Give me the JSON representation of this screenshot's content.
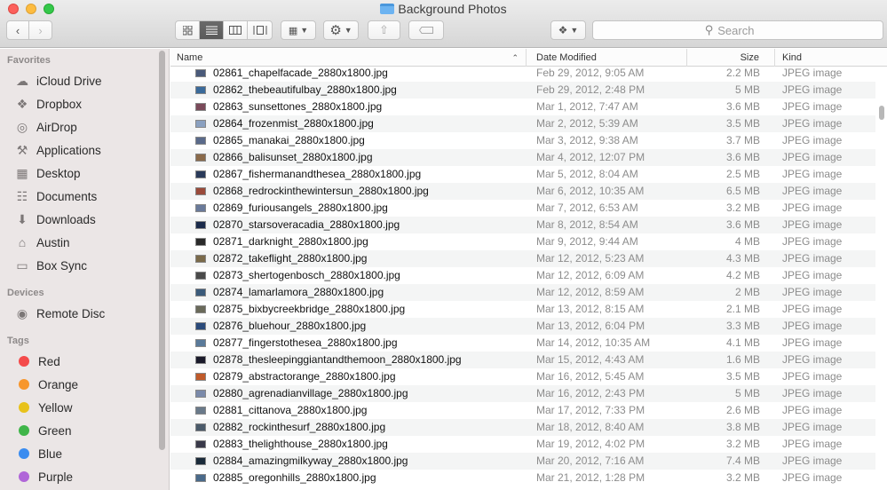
{
  "window": {
    "title": "Background Photos"
  },
  "toolbar": {
    "back_icon": "chevron-left-icon",
    "forward_icon": "chevron-right-icon",
    "view_modes": [
      "icon-view",
      "list-view",
      "column-view",
      "coverflow-view"
    ],
    "active_view": "list-view",
    "search_placeholder": "Search"
  },
  "sidebar": {
    "favorites_heading": "Favorites",
    "favorites": [
      {
        "label": "iCloud Drive",
        "icon": "cloud-icon"
      },
      {
        "label": "Dropbox",
        "icon": "dropbox-icon"
      },
      {
        "label": "AirDrop",
        "icon": "airdrop-icon"
      },
      {
        "label": "Applications",
        "icon": "applications-icon"
      },
      {
        "label": "Desktop",
        "icon": "desktop-icon"
      },
      {
        "label": "Documents",
        "icon": "documents-icon"
      },
      {
        "label": "Downloads",
        "icon": "downloads-icon"
      },
      {
        "label": "Austin",
        "icon": "home-icon"
      },
      {
        "label": "Box Sync",
        "icon": "folder-icon"
      }
    ],
    "devices_heading": "Devices",
    "devices": [
      {
        "label": "Remote Disc",
        "icon": "disc-icon"
      }
    ],
    "tags_heading": "Tags",
    "tags": [
      {
        "label": "Red",
        "color": "#f44a4a"
      },
      {
        "label": "Orange",
        "color": "#f7962c"
      },
      {
        "label": "Yellow",
        "color": "#e8c21b"
      },
      {
        "label": "Green",
        "color": "#3fb549"
      },
      {
        "label": "Blue",
        "color": "#3a8cf0"
      },
      {
        "label": "Purple",
        "color": "#b066d8"
      }
    ]
  },
  "columns": {
    "name": "Name",
    "date": "Date Modified",
    "size": "Size",
    "kind": "Kind"
  },
  "files": [
    {
      "name": "02861_chapelfacade_2880x1800.jpg",
      "date": "Feb 29, 2012, 9:05 AM",
      "size": "2.2 MB",
      "kind": "JPEG image"
    },
    {
      "name": "02862_thebeautifulbay_2880x1800.jpg",
      "date": "Feb 29, 2012, 2:48 PM",
      "size": "5 MB",
      "kind": "JPEG image"
    },
    {
      "name": "02863_sunsettones_2880x1800.jpg",
      "date": "Mar 1, 2012, 7:47 AM",
      "size": "3.6 MB",
      "kind": "JPEG image"
    },
    {
      "name": "02864_frozenmist_2880x1800.jpg",
      "date": "Mar 2, 2012, 5:39 AM",
      "size": "3.5 MB",
      "kind": "JPEG image"
    },
    {
      "name": "02865_manakai_2880x1800.jpg",
      "date": "Mar 3, 2012, 9:38 AM",
      "size": "3.7 MB",
      "kind": "JPEG image"
    },
    {
      "name": "02866_balisunset_2880x1800.jpg",
      "date": "Mar 4, 2012, 12:07 PM",
      "size": "3.6 MB",
      "kind": "JPEG image"
    },
    {
      "name": "02867_fishermanandthesea_2880x1800.jpg",
      "date": "Mar 5, 2012, 8:04 AM",
      "size": "2.5 MB",
      "kind": "JPEG image"
    },
    {
      "name": "02868_redrockinthewintersun_2880x1800.jpg",
      "date": "Mar 6, 2012, 10:35 AM",
      "size": "6.5 MB",
      "kind": "JPEG image"
    },
    {
      "name": "02869_furiousangels_2880x1800.jpg",
      "date": "Mar 7, 2012, 6:53 AM",
      "size": "3.2 MB",
      "kind": "JPEG image"
    },
    {
      "name": "02870_starsoveracadia_2880x1800.jpg",
      "date": "Mar 8, 2012, 8:54 AM",
      "size": "3.6 MB",
      "kind": "JPEG image"
    },
    {
      "name": "02871_darknight_2880x1800.jpg",
      "date": "Mar 9, 2012, 9:44 AM",
      "size": "4 MB",
      "kind": "JPEG image"
    },
    {
      "name": "02872_takeflight_2880x1800.jpg",
      "date": "Mar 12, 2012, 5:23 AM",
      "size": "4.3 MB",
      "kind": "JPEG image"
    },
    {
      "name": "02873_shertogenbosch_2880x1800.jpg",
      "date": "Mar 12, 2012, 6:09 AM",
      "size": "4.2 MB",
      "kind": "JPEG image"
    },
    {
      "name": "02874_lamarlamora_2880x1800.jpg",
      "date": "Mar 12, 2012, 8:59 AM",
      "size": "2 MB",
      "kind": "JPEG image"
    },
    {
      "name": "02875_bixbycreekbridge_2880x1800.jpg",
      "date": "Mar 13, 2012, 8:15 AM",
      "size": "2.1 MB",
      "kind": "JPEG image"
    },
    {
      "name": "02876_bluehour_2880x1800.jpg",
      "date": "Mar 13, 2012, 6:04 PM",
      "size": "3.3 MB",
      "kind": "JPEG image"
    },
    {
      "name": "02877_fingerstothesea_2880x1800.jpg",
      "date": "Mar 14, 2012, 10:35 AM",
      "size": "4.1 MB",
      "kind": "JPEG image"
    },
    {
      "name": "02878_thesleepinggiantandthemoon_2880x1800.jpg",
      "date": "Mar 15, 2012, 4:43 AM",
      "size": "1.6 MB",
      "kind": "JPEG image"
    },
    {
      "name": "02879_abstractorange_2880x1800.jpg",
      "date": "Mar 16, 2012, 5:45 AM",
      "size": "3.5 MB",
      "kind": "JPEG image"
    },
    {
      "name": "02880_agrenadianvillage_2880x1800.jpg",
      "date": "Mar 16, 2012, 2:43 PM",
      "size": "5 MB",
      "kind": "JPEG image"
    },
    {
      "name": "02881_cittanova_2880x1800.jpg",
      "date": "Mar 17, 2012, 7:33 PM",
      "size": "2.6 MB",
      "kind": "JPEG image"
    },
    {
      "name": "02882_rockinthesurf_2880x1800.jpg",
      "date": "Mar 18, 2012, 8:40 AM",
      "size": "3.8 MB",
      "kind": "JPEG image"
    },
    {
      "name": "02883_thelighthouse_2880x1800.jpg",
      "date": "Mar 19, 2012, 4:02 PM",
      "size": "3.2 MB",
      "kind": "JPEG image"
    },
    {
      "name": "02884_amazingmilkyway_2880x1800.jpg",
      "date": "Mar 20, 2012, 7:16 AM",
      "size": "7.4 MB",
      "kind": "JPEG image"
    },
    {
      "name": "02885_oregonhills_2880x1800.jpg",
      "date": "Mar 21, 2012, 1:28 PM",
      "size": "3.2 MB",
      "kind": "JPEG image"
    }
  ]
}
